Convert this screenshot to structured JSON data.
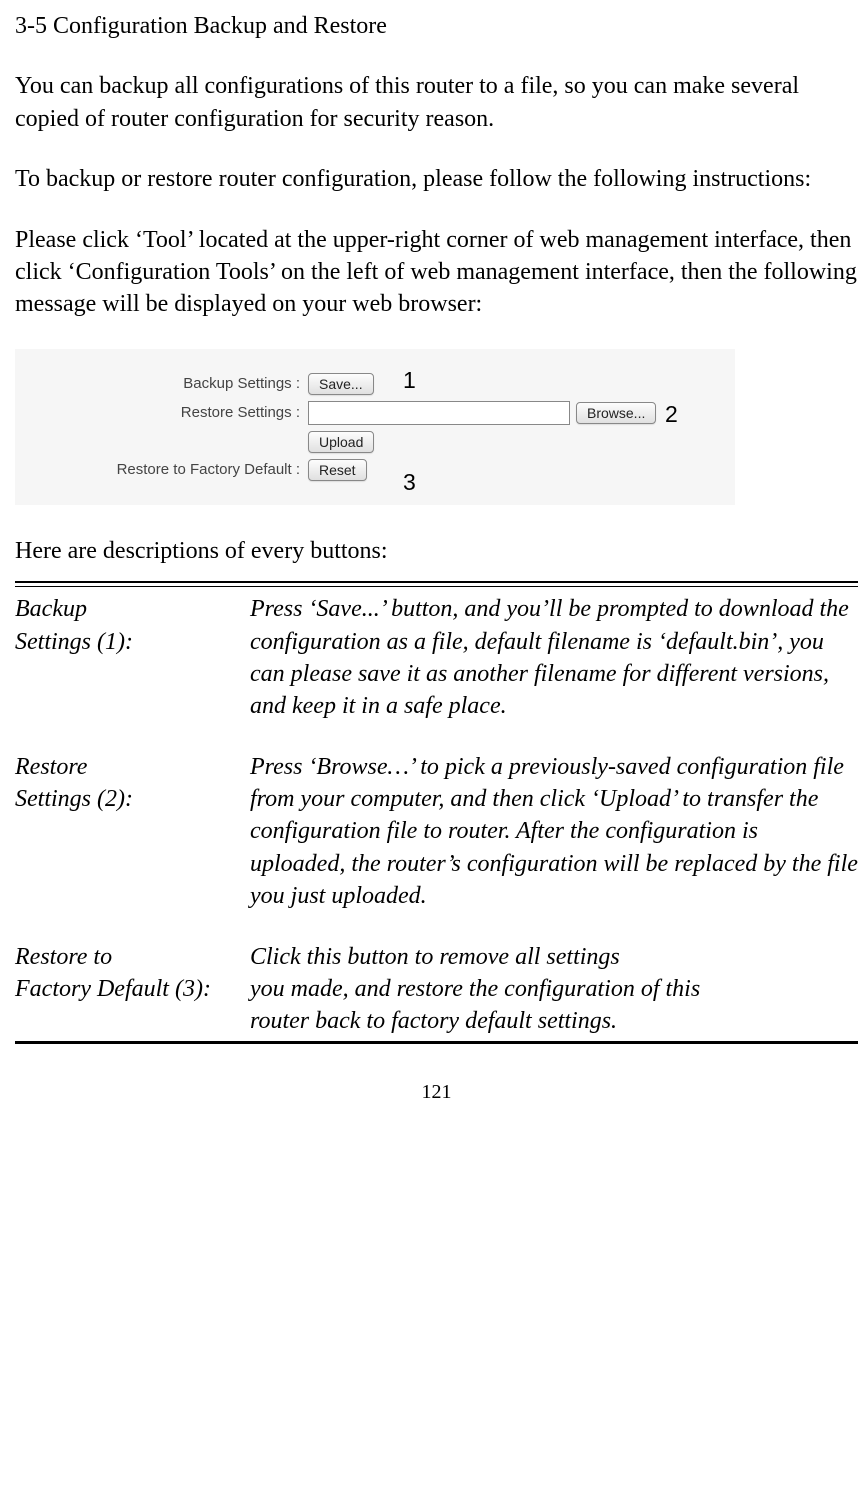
{
  "title": "3-5 Configuration Backup and Restore",
  "para1": "You can backup all configurations of this router to a file, so you can make several copied of router configuration for security reason.",
  "para2": "To backup or restore router configuration, please follow the following instructions:",
  "para3": "Please click ‘Tool’ located at the upper-right corner of web management interface, then click ‘Configuration Tools’ on the left of web management interface, then the following message will be displayed on your web browser:",
  "screenshot": {
    "backup_label": "Backup Settings :",
    "save_button": "Save...",
    "restore_label": "Restore Settings :",
    "browse_button": "Browse...",
    "upload_button": "Upload",
    "factory_label": "Restore to Factory Default :",
    "reset_button": "Reset",
    "callout_1": "1",
    "callout_2": "2",
    "callout_3": "3"
  },
  "desc_intro": "Here are descriptions of every buttons:",
  "descriptions": [
    {
      "name_line1": "Backup",
      "name_line2": "Settings (1):",
      "text": "Press ‘Save...’ button, and you’ll be prompted to download the configuration as a file, default filename is ‘default.bin’, you can please save it as another filename for different versions, and keep it in a safe place."
    },
    {
      "name_line1": "Restore",
      "name_line2": "Settings (2):",
      "text": "Press ‘Browse…’ to pick a previously-saved configuration file from your computer, and then click ‘Upload’ to transfer the configuration file to router. After the configuration is uploaded, the router’s configuration will be replaced by the file you just uploaded."
    },
    {
      "name_line1": "Restore to",
      "name_line2": "Factory Default (3):",
      "text_line1": "Click this button to remove all settings",
      "text_line2": "you made, and restore the configuration of this",
      "text_line3": "router back to factory default settings."
    }
  ],
  "page_number": "121"
}
